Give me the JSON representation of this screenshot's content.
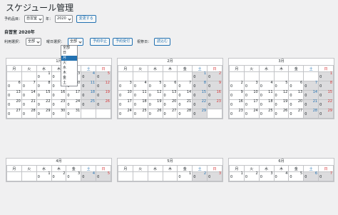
{
  "page_title": "スケジュール管理",
  "toolbar": {
    "item_label": "予約品目：",
    "item_value": "自習室",
    "year_label": "年：",
    "year_value": "2020",
    "change_button": "変更する"
  },
  "subheading": "自習室 2020年",
  "filters": {
    "usage_label": "利用選択：",
    "usage_value": "全部",
    "weekday_label": "曜日選択：",
    "weekday_value": "全部",
    "btn_suspend": "予約中止",
    "btn_resume": "予約受付",
    "holiday_label": "祝祭日：",
    "btn_load": "読込む"
  },
  "weekday_dropdown": [
    "全部",
    "日",
    "月",
    "火",
    "水",
    "木",
    "金",
    "土"
  ],
  "weekday_headers": [
    "月",
    "火",
    "水",
    "木",
    "金",
    "土",
    "日"
  ],
  "months": [
    {
      "label": "1月",
      "rows": [
        [
          "",
          "",
          "1",
          "2",
          "3",
          "4",
          "5"
        ],
        [
          "6",
          "7",
          "8",
          "9",
          "10",
          "11",
          "12"
        ],
        [
          "13",
          "14",
          "15",
          "16",
          "17",
          "18",
          "19"
        ],
        [
          "20",
          "21",
          "22",
          "23",
          "24",
          "25",
          "26"
        ],
        [
          "27",
          "28",
          "29",
          "30",
          "31",
          "",
          ""
        ]
      ]
    },
    {
      "label": "2月",
      "rows": [
        [
          "",
          "",
          "",
          "",
          "",
          "1",
          "2"
        ],
        [
          "3",
          "4",
          "5",
          "6",
          "7",
          "8",
          "9"
        ],
        [
          "10",
          "11",
          "12",
          "13",
          "14",
          "15",
          "16"
        ],
        [
          "17",
          "18",
          "19",
          "20",
          "21",
          "22",
          "23"
        ],
        [
          "24",
          "25",
          "26",
          "27",
          "28",
          "29",
          ""
        ]
      ]
    },
    {
      "label": "3月",
      "rows": [
        [
          "",
          "",
          "",
          "",
          "",
          "",
          "1"
        ],
        [
          "2",
          "3",
          "4",
          "5",
          "6",
          "7",
          "8"
        ],
        [
          "9",
          "10",
          "11",
          "12",
          "13",
          "14",
          "15"
        ],
        [
          "16",
          "17",
          "18",
          "19",
          "20",
          "21",
          "22"
        ],
        [
          "23",
          "24",
          "25",
          "26",
          "27",
          "28",
          "29"
        ]
      ]
    },
    {
      "label": "4月",
      "rows": [
        [
          "",
          "",
          "1",
          "2",
          "3",
          "4",
          "5"
        ]
      ]
    },
    {
      "label": "5月",
      "rows": [
        [
          "",
          "",
          "",
          "",
          "1",
          "2",
          "3"
        ]
      ]
    },
    {
      "label": "6月",
      "rows": [
        [
          "1",
          "2",
          "3",
          "4",
          "5",
          "6",
          "7"
        ]
      ]
    }
  ],
  "zero": "0"
}
